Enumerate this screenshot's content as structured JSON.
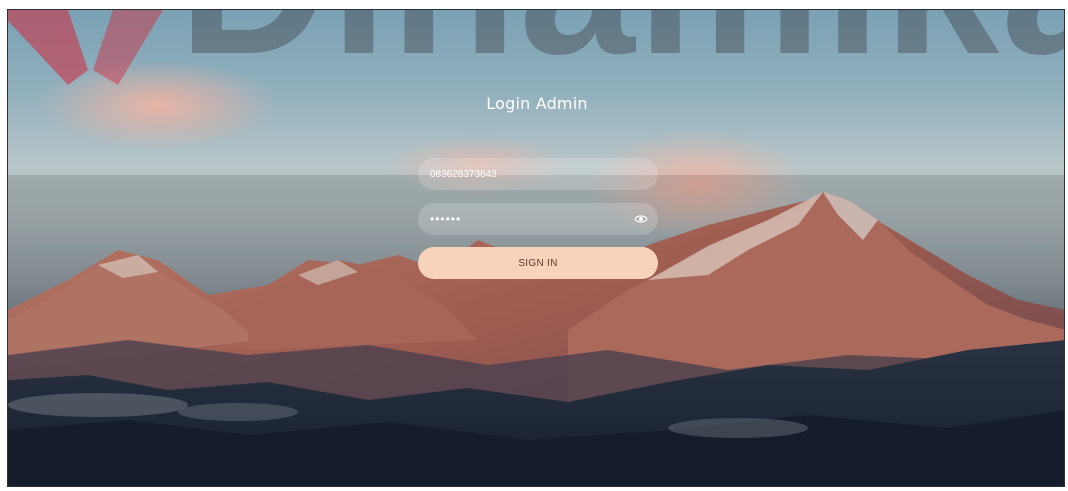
{
  "watermark": {
    "text": "Dinamika"
  },
  "login": {
    "title": "Login Admin",
    "username_value": "083628373643",
    "password_value": "••••••",
    "signin_label": "SIGN IN"
  },
  "icons": {
    "password_toggle": "eye-icon"
  },
  "colors": {
    "button_bg": "#f8d3bb",
    "button_text": "#5a3b32",
    "title_text": "#ffffff"
  }
}
